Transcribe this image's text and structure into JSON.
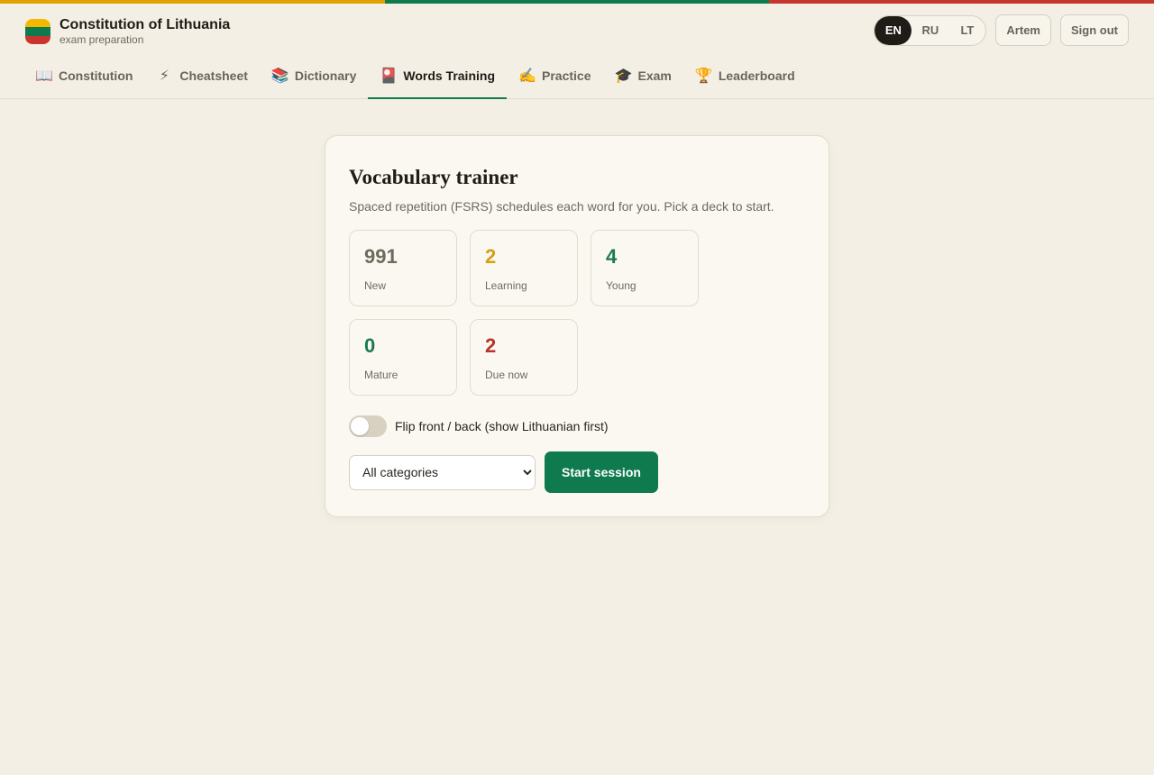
{
  "colors": {
    "flag_yellow": "#e1a200",
    "flag_green": "#0f7a4e",
    "flag_red": "#c8352f",
    "accent_green": "#0f7a4e",
    "stat_new": "#6b6b5e",
    "stat_learning": "#d3a018",
    "stat_young": "#1a7a55",
    "stat_mature": "#1a7a55",
    "stat_due": "#b5352c"
  },
  "header": {
    "title": "Constitution of Lithuania",
    "subtitle": "exam preparation",
    "languages": [
      "EN",
      "RU",
      "LT"
    ],
    "active_language": "EN",
    "user_name": "Artem",
    "sign_out_label": "Sign out"
  },
  "tabs": [
    {
      "icon": "book-icon",
      "glyph": "📖",
      "label": "Constitution"
    },
    {
      "icon": "lightning-icon",
      "glyph": "⚡",
      "label": "Cheatsheet"
    },
    {
      "icon": "books-icon",
      "glyph": "📚",
      "label": "Dictionary"
    },
    {
      "icon": "cards-icon",
      "glyph": "🎴",
      "label": "Words Training",
      "active": true
    },
    {
      "icon": "writing-hand-icon",
      "glyph": "✍️",
      "label": "Practice"
    },
    {
      "icon": "graduation-cap-icon",
      "glyph": "🎓",
      "label": "Exam"
    },
    {
      "icon": "trophy-icon",
      "glyph": "🏆",
      "label": "Leaderboard"
    }
  ],
  "trainer": {
    "title": "Vocabulary trainer",
    "subtitle": "Spaced repetition (FSRS) schedules each word for you. Pick a deck to start.",
    "stats": [
      {
        "value": "991",
        "label": "New",
        "color": "#6b6b5e"
      },
      {
        "value": "2",
        "label": "Learning",
        "color": "#d3a018"
      },
      {
        "value": "4",
        "label": "Young",
        "color": "#1a7a55"
      },
      {
        "value": "0",
        "label": "Mature",
        "color": "#1a7a55"
      },
      {
        "value": "2",
        "label": "Due now",
        "color": "#b5352c"
      }
    ],
    "flip_label": "Flip front / back (show Lithuanian first)",
    "flip_on": false,
    "category_selected": "All categories",
    "start_label": "Start session"
  }
}
